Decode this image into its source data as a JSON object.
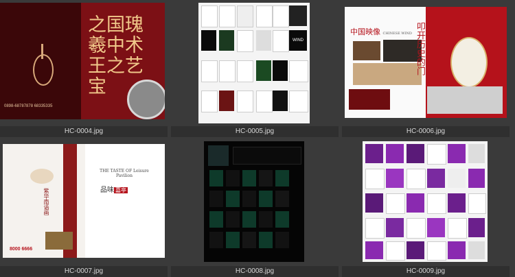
{
  "files": [
    {
      "name": "HC-0004.jpg",
      "title_lines": [
        "之国瑰",
        "羲中术",
        "王之艺",
        "宝"
      ],
      "footer": "0898-68787878 68335335"
    },
    {
      "name": "HC-0005.jpg",
      "panel_text": "WIND"
    },
    {
      "name": "HC-0006.jpg",
      "brand": "中国映像",
      "brand_sub": "CHINESE WIND",
      "side_text": "叩开历史的门"
    },
    {
      "name": "HC-0007.jpg",
      "tagline": "THE TASTE OF Leisure Pavilion",
      "brand": "品味",
      "brand_tag": "嘉亭",
      "left_text": "紫华南语画",
      "phone": "8000 6666"
    },
    {
      "name": "HC-0008.jpg"
    },
    {
      "name": "HC-0009.jpg"
    }
  ]
}
